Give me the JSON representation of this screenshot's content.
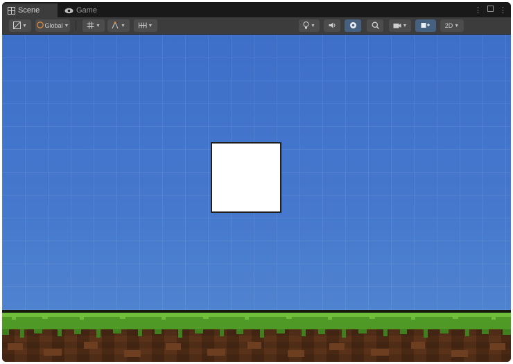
{
  "tabs": [
    {
      "label": "Scene",
      "icon": "scene-grid-icon",
      "active": true
    },
    {
      "label": "Game",
      "icon": "eye-icon",
      "active": false
    }
  ],
  "toolbar": {
    "pivot_label": "Global",
    "zoom_label": "2D"
  },
  "colors": {
    "editor_bg": "#191919",
    "toolbar_bg": "#3c3c3c",
    "sky_top": "#3d6fc9",
    "sky_bottom": "#5489d2",
    "grass": "#4f9a26",
    "dirt": "#5a3219",
    "sprite": "#ffffff",
    "active_toggle": "#46607f"
  }
}
